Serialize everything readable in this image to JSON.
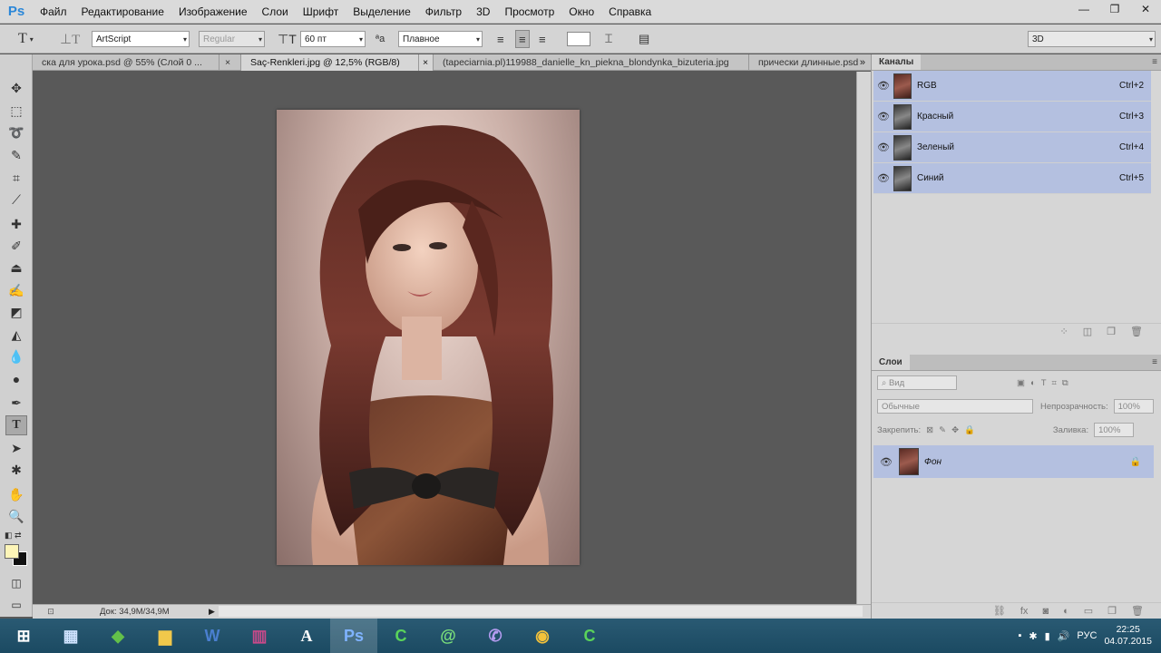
{
  "app": {
    "logo": "Ps"
  },
  "menu": [
    "Файл",
    "Редактирование",
    "Изображение",
    "Слои",
    "Шрифт",
    "Выделение",
    "Фильтр",
    "3D",
    "Просмотр",
    "Окно",
    "Справка"
  ],
  "window_controls": {
    "minimize": "—",
    "restore": "❐",
    "close": "✕"
  },
  "options": {
    "font_family": "ArtScript",
    "font_style": "Regular",
    "font_size": "60 пт",
    "aa_label": "ªa",
    "antialias": "Плавное",
    "workspace": "3D"
  },
  "tabs": [
    {
      "label": "ска для урока.psd @ 55% (Слой 0 ...",
      "active": false
    },
    {
      "label": "Saç-Renkleri.jpg @ 12,5% (RGB/8)",
      "active": true
    },
    {
      "label": "(tapeciarnia.pl)119988_danielle_kn_piekna_blondynka_bizuteria.jpg",
      "active": false
    },
    {
      "label": "прически длинные.psd",
      "active": false
    }
  ],
  "tabs_more": "»",
  "status": {
    "doc": "Док: 34,9M/34,9M"
  },
  "channels_panel": {
    "title": "Каналы",
    "rows": [
      {
        "name": "RGB",
        "shortcut": "Ctrl+2",
        "thumb": "color"
      },
      {
        "name": "Красный",
        "shortcut": "Ctrl+3",
        "thumb": "gray"
      },
      {
        "name": "Зеленый",
        "shortcut": "Ctrl+4",
        "thumb": "gray"
      },
      {
        "name": "Синий",
        "shortcut": "Ctrl+5",
        "thumb": "gray"
      }
    ]
  },
  "layers_panel": {
    "title": "Слои",
    "filter": "Вид",
    "blend": "Обычные",
    "opacity_label": "Непрозрачность:",
    "opacity": "100%",
    "lock_label": "Закрепить:",
    "fill_label": "Заливка:",
    "fill": "100%",
    "layers": [
      {
        "name": "Фон",
        "locked": true
      }
    ]
  },
  "taskbar": {
    "apps": [
      "start",
      "calculator",
      "chrome-green",
      "explorer",
      "word",
      "winrar",
      "font-app",
      "photoshop",
      "camtasia",
      "mail-agent",
      "viber",
      "chrome",
      "camtasia-2"
    ],
    "active": "photoshop",
    "language": "РУС",
    "time": "22:25",
    "date": "04.07.2015"
  },
  "colors": {
    "foreground": "#fdf5b8",
    "background": "#111111",
    "selection": "#b4c0e0"
  }
}
